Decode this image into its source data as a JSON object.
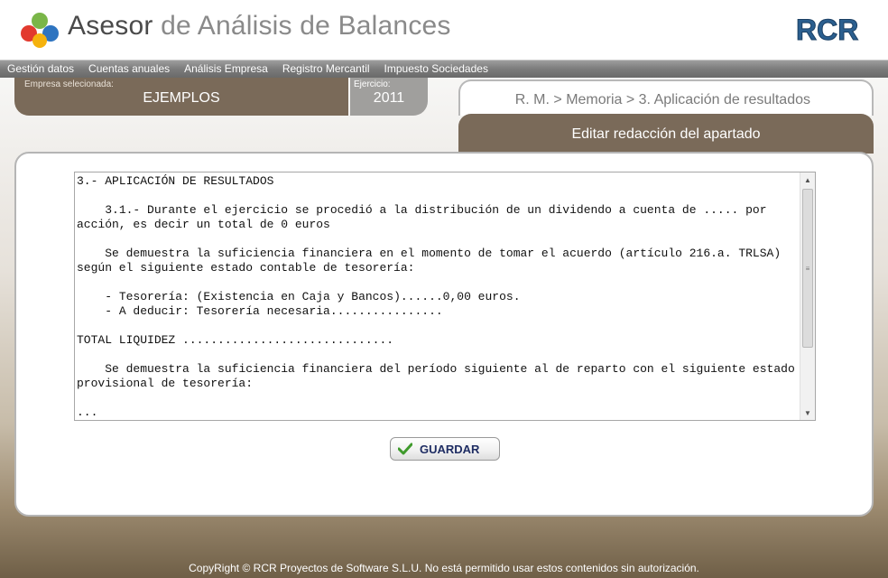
{
  "header": {
    "title_part1": "Asesor",
    "title_part2": "de Análisis de Balances",
    "brand": "RCR"
  },
  "menu": {
    "items": [
      {
        "label": "Gestión datos"
      },
      {
        "label": "Cuentas anuales"
      },
      {
        "label": "Análisis Empresa"
      },
      {
        "label": "Registro Mercantil"
      },
      {
        "label": "Impuesto Sociedades"
      }
    ]
  },
  "company": {
    "label": "Empresa selecionada:",
    "value": "EJEMPLOS"
  },
  "year": {
    "label": "Ejercicio:",
    "value": "2011"
  },
  "breadcrumb": "R. M. > Memoria > 3. Aplicación de resultados",
  "edit_tab": "Editar redacción del apartado",
  "editor": {
    "text": "3.- APLICACIÓN DE RESULTADOS\n\n    3.1.- Durante el ejercicio se procedió a la distribución de un dividendo a cuenta de ..... por acción, es decir un total de 0 euros\n\n    Se demuestra la suficiencia financiera en el momento de tomar el acuerdo (artículo 216.a. TRLSA) según el siguiente estado contable de tesorería:\n\n    - Tesorería: (Existencia en Caja y Bancos)......0,00 euros.\n    - A deducir: Tesorería necesaria................\n\nTOTAL LIQUIDEZ ..............................\n\n    Se demuestra la suficiencia financiera del período siguiente al de reparto con el siguiente estado provisional de tesorería:\n\n..."
  },
  "save_button": {
    "label": "GUARDAR"
  },
  "footer": "CopyRight © RCR Proyectos de Software S.L.U. No está permitido usar estos contenidos sin autorización.",
  "colors": {
    "accent_brown": "#7a6a59",
    "year_gray": "#a09f9d",
    "menu_gray": "#7b7b7b",
    "save_text": "#1f2d63"
  }
}
